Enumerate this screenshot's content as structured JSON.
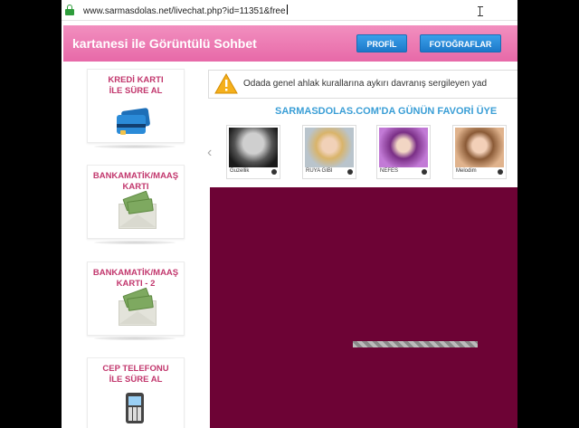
{
  "browser": {
    "url": "www.sarmasdolas.net/livechat.php?id=11351&free"
  },
  "header": {
    "title": "kartanesi ile Görüntülü Sohbet",
    "buttons": [
      {
        "label": "PROFİL"
      },
      {
        "label": "FOTOĞRAFLAR"
      }
    ]
  },
  "sidebar": {
    "cards": [
      {
        "title": "KREDİ KARTI İLE SÜRE AL",
        "icon": "credit-card-icon"
      },
      {
        "title": "BANKAMATİK/MAAŞ KARTI",
        "icon": "money-envelope-icon"
      },
      {
        "title": "BANKAMATİK/MAAŞ KARTI - 2",
        "icon": "money-envelope-icon"
      },
      {
        "title": "CEP TELEFONU İLE SÜRE AL",
        "icon": "mobile-phone-icon"
      }
    ]
  },
  "warning": {
    "text": "Odada genel ahlak kurallarına aykırı davranış sergileyen yad",
    "icon": "warning-icon"
  },
  "favorites": {
    "title": "SARMASDOLAS.COM'DA GÜNÜN FAVORİ ÜYE",
    "members": [
      {
        "name": "Guzellik"
      },
      {
        "name": "RUYA GIBI"
      },
      {
        "name": "NEFES"
      },
      {
        "name": "Melodim"
      }
    ]
  },
  "colors": {
    "header_pink": "#ea74ad",
    "button_blue": "#2a8ad8",
    "card_title": "#c2376d",
    "favorites_title": "#3a9ed6",
    "video_bg": "#6d0335"
  }
}
